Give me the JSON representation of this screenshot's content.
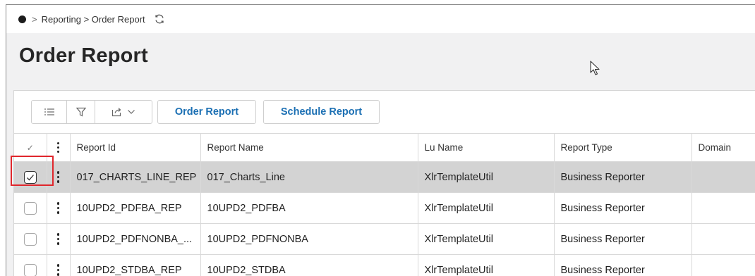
{
  "breadcrumb": {
    "separator": ">",
    "path_text": "Reporting > Order Report",
    "home_icon": "home-dot-icon",
    "refresh_icon": "refresh-icon"
  },
  "page": {
    "title": "Order Report"
  },
  "toolbar": {
    "list_icon": "list-icon",
    "filter_icon": "filter-icon",
    "export_icon": "export-icon",
    "order_report_label": "Order Report",
    "schedule_report_label": "Schedule Report"
  },
  "table": {
    "select_header": "✓",
    "columns": [
      "Report Id",
      "Report Name",
      "Lu Name",
      "Report Type",
      "Domain"
    ],
    "rows": [
      {
        "selected": true,
        "report_id": "017_CHARTS_LINE_REP",
        "report_name": "017_Charts_Line",
        "lu_name": "XlrTemplateUtil",
        "report_type": "Business Reporter",
        "domain": ""
      },
      {
        "selected": false,
        "report_id": "10UPD2_PDFBA_REP",
        "report_name": "10UPD2_PDFBA",
        "lu_name": "XlrTemplateUtil",
        "report_type": "Business Reporter",
        "domain": ""
      },
      {
        "selected": false,
        "report_id": "10UPD2_PDFNONBA_...",
        "report_name": "10UPD2_PDFNONBA",
        "lu_name": "XlrTemplateUtil",
        "report_type": "Business Reporter",
        "domain": ""
      },
      {
        "selected": false,
        "report_id": "10UPD2_STDBA_REP",
        "report_name": "10UPD2_STDBA",
        "lu_name": "XlrTemplateUtil",
        "report_type": "Business Reporter",
        "domain": ""
      }
    ]
  },
  "colors": {
    "accent": "#1b6fb3",
    "highlight": "#e0262c",
    "selected_row": "#d3d3d3",
    "page_bg": "#f1f1f2"
  }
}
